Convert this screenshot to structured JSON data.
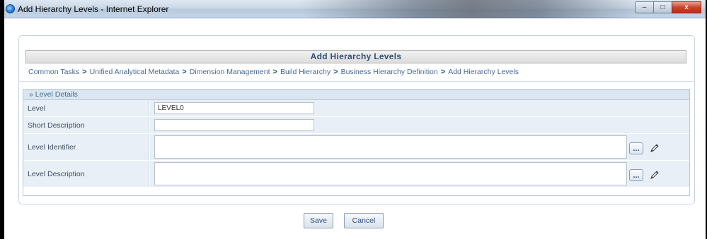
{
  "window": {
    "title": "Add Hierarchy Levels - Internet Explorer",
    "controls": {
      "minimize": "–",
      "maximize": "□",
      "close": "x"
    }
  },
  "page": {
    "header": "Add Hierarchy Levels",
    "breadcrumb": [
      "Common Tasks",
      "Unified Analytical Metadata",
      "Dimension Management",
      "Build Hierarchy",
      "Business Hierarchy Definition",
      "Add Hierarchy Levels"
    ],
    "breadcrumb_separator": ">"
  },
  "level_details": {
    "section_title": "»  Level Details",
    "fields": [
      {
        "label": "Level",
        "value": "LEVEL0"
      },
      {
        "label": "Short Description",
        "value": ""
      },
      {
        "label": "Level Identifier",
        "value": ""
      },
      {
        "label": "Level Description",
        "value": ""
      }
    ],
    "browse_button_label": "..."
  },
  "actions": {
    "save_label": "Save",
    "cancel_label": "Cancel"
  },
  "icons": {
    "app": "internet-explorer-icon",
    "edit": "pencil-icon"
  },
  "colors": {
    "header_text": "#2f4f7a",
    "breadcrumb_text": "#4a6a8e",
    "section_bg": "#e9eff6",
    "section_head_bg": "#dbe6f1"
  }
}
